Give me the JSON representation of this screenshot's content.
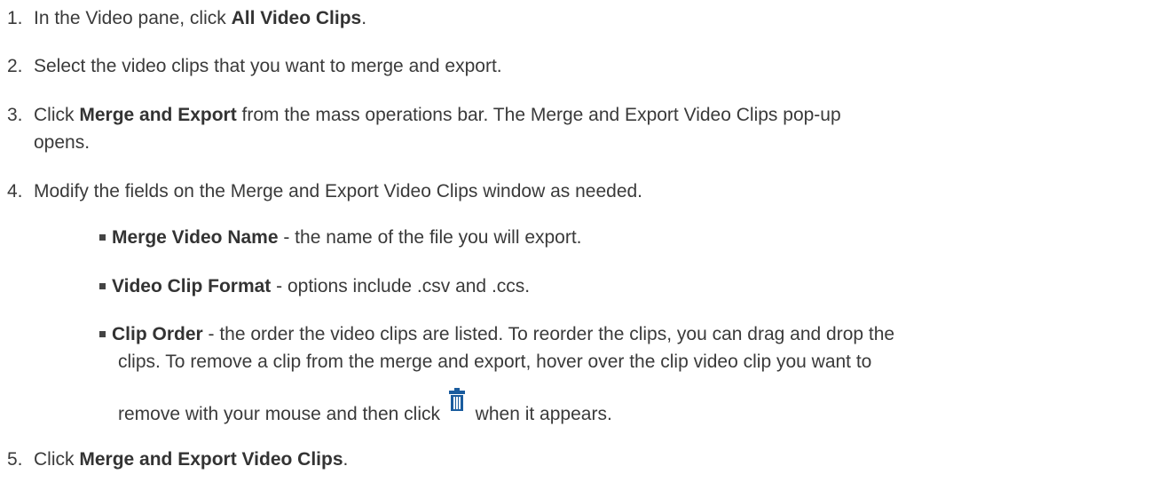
{
  "steps": [
    {
      "num": "1.",
      "pre": "In the Video pane, click ",
      "bold": "All Video Clips",
      "post": "."
    },
    {
      "num": "2.",
      "text": "Select the video clips that you want to merge and export."
    },
    {
      "num": "3.",
      "pre": "Click ",
      "bold": "Merge and Export",
      "post": " from the mass operations bar. The Merge and Export Video Clips pop-up",
      "cont": "opens."
    },
    {
      "num": "4.",
      "text": "Modify the fields on the Merge and Export Video Clips window as needed."
    },
    {
      "num": "5.",
      "pre": "Click ",
      "bold": "Merge and Export Video Clips",
      "post": "."
    }
  ],
  "bullets": [
    {
      "bold": "Merge Video Name",
      "text": " - the name of the file you will export."
    },
    {
      "bold": "Video Clip Format",
      "text": " - options include .csv and .ccs."
    },
    {
      "bold": "Clip Order",
      "text": " - the order the video clips are listed. To reorder the clips, you can drag and drop the",
      "line2": "clips. To remove a clip from the merge and export, hover over the clip video clip you want to",
      "line3_pre": "remove with your mouse and then click ",
      "line3_post": " when it appears."
    }
  ],
  "icons": {
    "trash": "trash-icon",
    "trash_color": "#1a5c9e"
  }
}
